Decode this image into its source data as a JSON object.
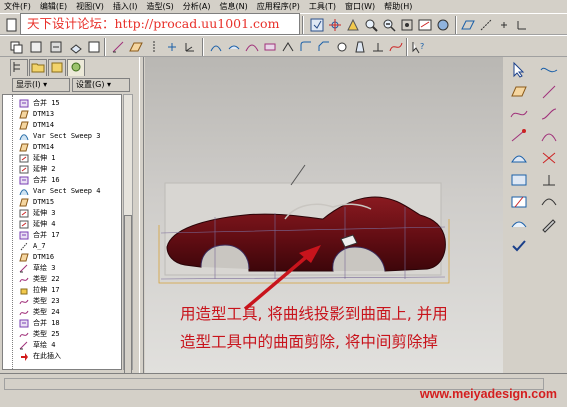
{
  "menu": [
    "文件(F)",
    "编辑(E)",
    "视图(V)",
    "插入(I)",
    "造型(S)",
    "分析(A)",
    "信息(N)",
    "应用程序(P)",
    "工具(T)",
    "窗口(W)",
    "帮助(H)"
  ],
  "forum_text": "天下设计论坛：http://procad.uu1001.com",
  "panel": {
    "show_label": "显示(I) ▾",
    "settings_label": "设置(G) ▾"
  },
  "tree": [
    {
      "label": "合并 15",
      "icon": "merge-icon"
    },
    {
      "label": "DTM13",
      "icon": "datum-plane-icon"
    },
    {
      "label": "DTM14",
      "icon": "datum-plane-icon"
    },
    {
      "label": "Var Sect Sweep 3",
      "icon": "sweep-icon"
    },
    {
      "label": "DTM14",
      "icon": "datum-plane-icon"
    },
    {
      "label": "延伸 1",
      "icon": "extend-icon"
    },
    {
      "label": "延伸 2",
      "icon": "extend-icon"
    },
    {
      "label": "合并 16",
      "icon": "merge-icon"
    },
    {
      "label": "Var Sect Sweep 4",
      "icon": "sweep-icon"
    },
    {
      "label": "DTM15",
      "icon": "datum-plane-icon"
    },
    {
      "label": "延伸 3",
      "icon": "extend-icon"
    },
    {
      "label": "延伸 4",
      "icon": "extend-icon"
    },
    {
      "label": "合并 17",
      "icon": "merge-icon"
    },
    {
      "label": "A_7",
      "icon": "datum-axis-icon"
    },
    {
      "label": "DTM16",
      "icon": "datum-plane-icon"
    },
    {
      "label": "草绘 3",
      "icon": "sketch-icon"
    },
    {
      "label": "类型 22",
      "icon": "style-icon"
    },
    {
      "label": "拉伸 17",
      "icon": "extrude-icon"
    },
    {
      "label": "类型 23",
      "icon": "style-icon"
    },
    {
      "label": "类型 24",
      "icon": "style-icon"
    },
    {
      "label": "合并 18",
      "icon": "merge-icon"
    },
    {
      "label": "类型 25",
      "icon": "style-icon"
    },
    {
      "label": "草绘 4",
      "icon": "sketch-icon"
    },
    {
      "label": "在此插入",
      "icon": "insert-here-arrow-icon"
    }
  ],
  "annotation": {
    "line1": "用造型工具, 将曲线投影到曲面上, 并用",
    "line2": "造型工具中的曲面剪除, 将中间剪除掉"
  },
  "watermark": "www.meiyadesign.com",
  "colors": {
    "car_body": "#6b0f15",
    "annotation": "#c8141c",
    "watermark": "#d41f1f",
    "forum": "#e8302a"
  }
}
